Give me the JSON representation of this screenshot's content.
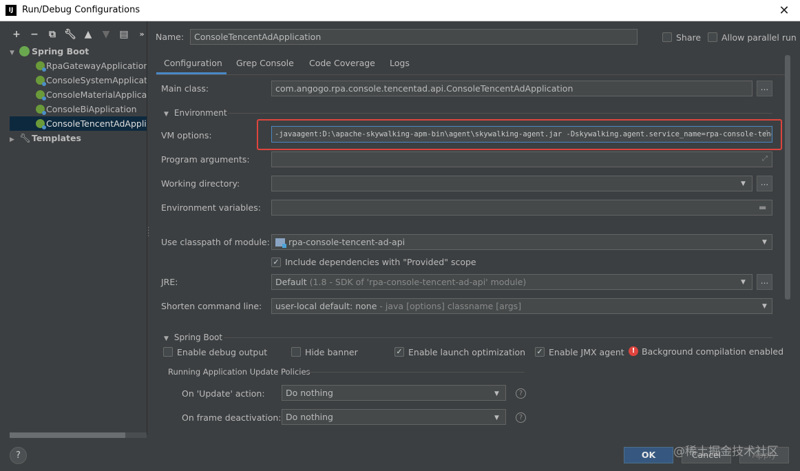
{
  "window": {
    "title": "Run/Debug Configurations",
    "app_icon": "IJ"
  },
  "toolbar": {
    "icons": [
      "add-icon",
      "remove-icon",
      "copy-icon",
      "wrench-icon",
      "arrow-up-icon",
      "arrow-down-icon",
      "folder-icon",
      "more-icon"
    ]
  },
  "tree": {
    "spring_boot": "Spring Boot",
    "items": [
      {
        "label": "RpaGatewayApplication",
        "selected": false
      },
      {
        "label": "ConsoleSystemApplication",
        "selected": false
      },
      {
        "label": "ConsoleMaterialApplication",
        "selected": false
      },
      {
        "label": "ConsoleBiApplication",
        "selected": false
      },
      {
        "label": "ConsoleTencentAdApplication",
        "selected": true
      }
    ],
    "templates": "Templates"
  },
  "header": {
    "name_label": "Name:",
    "name_value": "ConsoleTencentAdApplication",
    "share_label": "Share",
    "share_checked": false,
    "parallel_label": "Allow parallel run",
    "parallel_checked": false
  },
  "tabs": [
    "Configuration",
    "Grep Console",
    "Code Coverage",
    "Logs"
  ],
  "active_tab": "Configuration",
  "config": {
    "main_class_label": "Main class:",
    "main_class_value": "com.angogo.rpa.console.tencentad.api.ConsoleTencentAdApplication",
    "environment_section": "Environment",
    "vm_options_label": "VM options:",
    "vm_options_value": "-javaagent:D:\\apache-skywalking-apm-bin\\agent\\skywalking-agent.jar -Dskywalking.agent.service_name=rpa-console-tencen",
    "program_args_label": "Program arguments:",
    "program_args_value": "",
    "working_dir_label": "Working directory:",
    "working_dir_value": "",
    "env_vars_label": "Environment variables:",
    "env_vars_value": "",
    "classpath_label": "Use classpath of module:",
    "classpath_value": "rpa-console-tencent-ad-api",
    "include_deps_label": "Include dependencies with \"Provided\" scope",
    "include_deps_checked": true,
    "jre_label": "JRE:",
    "jre_value_main": "Default",
    "jre_value_detail": "(1.8 - SDK of 'rpa-console-tencent-ad-api' module)",
    "shorten_label": "Shorten command line:",
    "shorten_value_main": "user-local default: none",
    "shorten_value_detail": "- java [options] classname [args]"
  },
  "spring_boot": {
    "section": "Spring Boot",
    "debug_output": {
      "label": "Enable debug output",
      "checked": false
    },
    "hide_banner": {
      "label": "Hide banner",
      "checked": false
    },
    "launch_opt": {
      "label": "Enable launch optimization",
      "checked": true
    },
    "jmx_agent": {
      "label": "Enable JMX agent",
      "checked": true
    },
    "bg_compilation": "Background compilation enabled",
    "update_policies": "Running Application Update Policies",
    "on_update_label": "On 'Update' action:",
    "on_update_value": "Do nothing",
    "on_frame_label": "On frame deactivation:",
    "on_frame_value": "Do nothing"
  },
  "buttons": {
    "help": "?",
    "ok": "OK",
    "cancel": "Cancel",
    "apply": "Apply"
  },
  "watermark": "@稀土掘金技术社区",
  "colors": {
    "accent": "#4a88c7",
    "highlight_box": "#e0443e",
    "ok_button": "#365880",
    "background": "#3c3f41"
  }
}
